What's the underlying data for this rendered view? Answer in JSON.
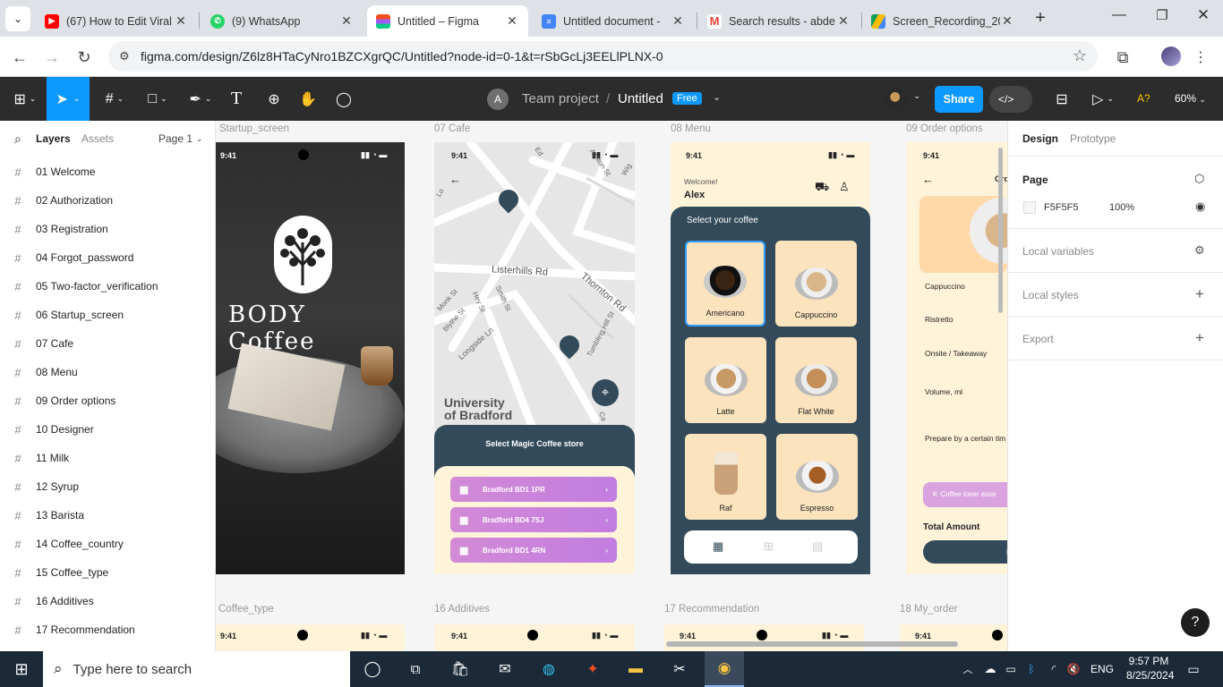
{
  "browser": {
    "tabs": [
      {
        "title": "(67) How to Edit Viral",
        "icon": "youtube-icon",
        "color": "#ff0000"
      },
      {
        "title": "(9) WhatsApp",
        "icon": "whatsapp-icon",
        "color": "#25d366"
      },
      {
        "title": "Untitled – Figma",
        "icon": "figma-icon",
        "color": "#f24e1e"
      },
      {
        "title": "Untitled document - ",
        "icon": "google-docs-icon",
        "color": "#4285f4"
      },
      {
        "title": "Search results - abde",
        "icon": "gmail-icon",
        "color": "#ea4335"
      },
      {
        "title": "Screen_Recording_20",
        "icon": "google-drive-icon",
        "color": "#fbbc04"
      }
    ],
    "url": "figma.com/design/Z6lz8HTaCyNro1BZCXgrQC/Untitled?node-id=0-1&t=rSbGcLj3EELlPLNX-0"
  },
  "toolbar": {
    "avatar_letter": "A",
    "team": "Team project",
    "separator": "/",
    "file": "Untitled",
    "plan_badge": "Free",
    "share": "Share",
    "access_badge": "A?",
    "zoom": "60%"
  },
  "left_panel": {
    "tab_layers": "Layers",
    "tab_assets": "Assets",
    "page_selector": "Page 1",
    "layers": [
      "01 Welcome",
      "02 Authorization",
      "03 Registration",
      "04 Forgot_password",
      "05 Two-factor_verification",
      "06 Startup_screen",
      "07 Cafe",
      "08 Menu",
      "09 Order options",
      "10 Designer",
      "11 Milk",
      "12 Syrup",
      "13 Barista",
      "14 Coffee_country",
      "15 Coffee_type",
      "16 Additives",
      "17 Recommendation"
    ]
  },
  "canvas": {
    "frame_labels_top": [
      "Startup_screen",
      "07 Cafe",
      "08 Menu",
      "09 Order options"
    ],
    "frame_labels_bottom": [
      "Coffee_type",
      "16 Additives",
      "17 Recommendation",
      "18 My_order"
    ],
    "status_time": "9:41",
    "startup": {
      "brand": "BODY Coffee"
    },
    "cafe": {
      "streets": [
        "Listerhills Rd",
        "Thornton Rd",
        "Longside Ln",
        "Smith St",
        "Hey St",
        "Blythe St",
        "Monk St",
        "Tumbling Hill St",
        "Ashton St",
        "Wig",
        "Ed",
        "Lo",
        "Ca"
      ],
      "landmark": "University\nof Bradford",
      "sheet_title": "Select Magic Coffee store",
      "stores": [
        "Bradford BD1 1PR",
        "Bradford BD4 7SJ",
        "Bradford BD1 4RN"
      ]
    },
    "menu": {
      "welcome": "Welcome!",
      "user": "Alex",
      "prompt": "Select your coffee",
      "items": [
        "Americano",
        "Cappuccino",
        "Latte",
        "Flat White",
        "Raf",
        "Espresso"
      ]
    },
    "order": {
      "title_partial": "Ord",
      "coffee_name": "Cappuccino",
      "options": [
        "Ristretto",
        "Onsite / Takeaway",
        "Volume, ml",
        "Prepare by a certain tim"
      ],
      "lover_btn": "Coffee lover asse",
      "total": "Total Amount",
      "next": "Ne"
    }
  },
  "right_panel": {
    "tab_design": "Design",
    "tab_prototype": "Prototype",
    "page_heading": "Page",
    "page_color": "F5F5F5",
    "page_opacity": "100%",
    "local_variables": "Local variables",
    "local_styles": "Local styles",
    "export": "Export",
    "help": "?"
  },
  "taskbar": {
    "search_placeholder": "Type here to search",
    "lang": "ENG",
    "time": "9:57 PM",
    "date": "8/25/2024"
  },
  "colors": {
    "figma_blue": "#0d99ff",
    "menu_panel": "#324a59",
    "cream": "#fbe3bd",
    "pill_purple": "#c983dc"
  }
}
